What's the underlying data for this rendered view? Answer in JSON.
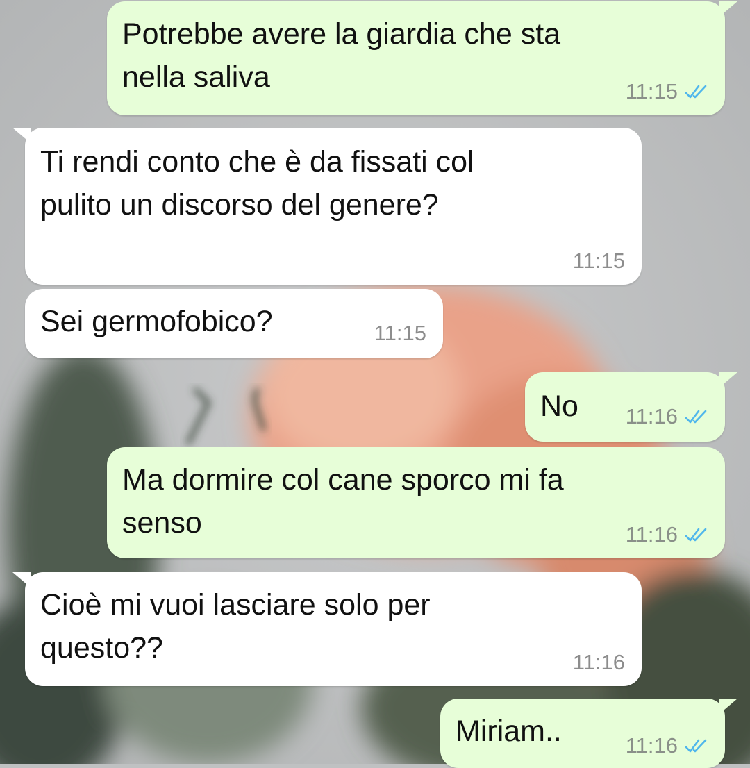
{
  "conversation": {
    "messages": [
      {
        "direction": "outgoing",
        "text": "Potrebbe avere la giardia che sta\nnella saliva",
        "time": "11:15",
        "status": "read"
      },
      {
        "direction": "incoming",
        "text": "Ti rendi conto che è da fissati col\npulito un discorso del genere?",
        "time": "11:15"
      },
      {
        "direction": "incoming",
        "text": "Sei germofobico?",
        "time": "11:15"
      },
      {
        "direction": "outgoing",
        "text": "No",
        "time": "11:16",
        "status": "read"
      },
      {
        "direction": "outgoing",
        "text": "Ma dormire col cane sporco mi fa\nsenso",
        "time": "11:16",
        "status": "read"
      },
      {
        "direction": "incoming",
        "text": "Cioè mi vuoi lasciare solo per\nquesto??",
        "time": "11:16"
      },
      {
        "direction": "outgoing",
        "text": "Miriam..",
        "time": "11:16",
        "status": "read"
      }
    ]
  },
  "colors": {
    "outgoing_bubble": "#e7fed8",
    "incoming_bubble": "#ffffff",
    "read_ticks": "#4fb6ec",
    "wallpaper": "#bfc1c2"
  },
  "icons": {
    "read_receipt": "double-check-icon"
  }
}
